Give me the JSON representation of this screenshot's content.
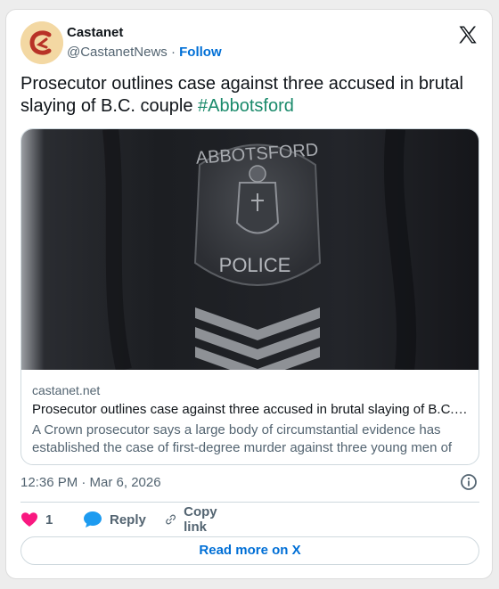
{
  "author": {
    "name": "Castanet",
    "handle": "@CastanetNews",
    "separator": " · ",
    "follow_label": "Follow"
  },
  "tweet": {
    "text": "Prosecutor outlines case against three accused in brutal slaying of B.C. couple ",
    "hashtag": "#Abbotsford"
  },
  "link_card": {
    "domain": "castanet.net",
    "title": "Prosecutor outlines case against three accused in brutal slaying of B.C. couple",
    "description": "A Crown prosecutor says a large body of circumstantial evidence has established the case of first-degree murder against three young men of Abbotsford",
    "badge_top": "ABBOTSFORD",
    "badge_bottom": "POLICE"
  },
  "timestamp": "12:36 PM · Mar 6, 2026",
  "actions": {
    "like_count": "1",
    "reply_label": "Reply",
    "copy_label": "Copy link"
  },
  "read_more_label": "Read more on X",
  "colors": {
    "accent": "#006fd6",
    "like": "#f91880",
    "reply": "#1d9bf0",
    "secondary_text": "#536471",
    "avatar_bg": "#f3d8a3",
    "avatar_logo": "#c0392b"
  }
}
